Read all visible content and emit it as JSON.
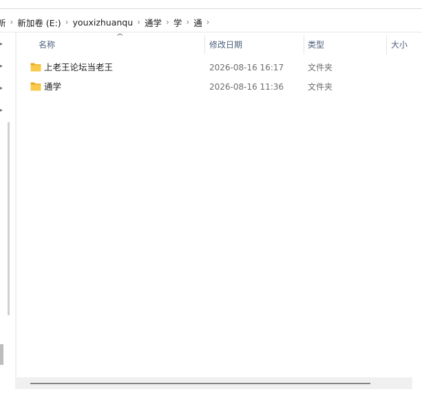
{
  "breadcrumb": {
    "items": [
      "新加卷 (E:)",
      "youxizhuanqu",
      "通学",
      "学",
      "通"
    ],
    "first_partial": "新",
    "separator": "›"
  },
  "columns": {
    "name": "名称",
    "date": "修改日期",
    "type": "类型",
    "size": "大小"
  },
  "files": [
    {
      "name": "上老王论坛当老王",
      "date": "2026-08-16 16:17",
      "type": "文件夹"
    },
    {
      "name": "通学",
      "date": "2026-08-16 11:36",
      "type": "文件夹"
    }
  ],
  "icons": {
    "folder": "folder-icon",
    "sort": "sort-ascending-icon",
    "nav_expand": "chevron-right-icon"
  },
  "colors": {
    "folder": "#F8C94A",
    "header_text": "#4C607A",
    "secondary_text": "#6D6D6D"
  }
}
